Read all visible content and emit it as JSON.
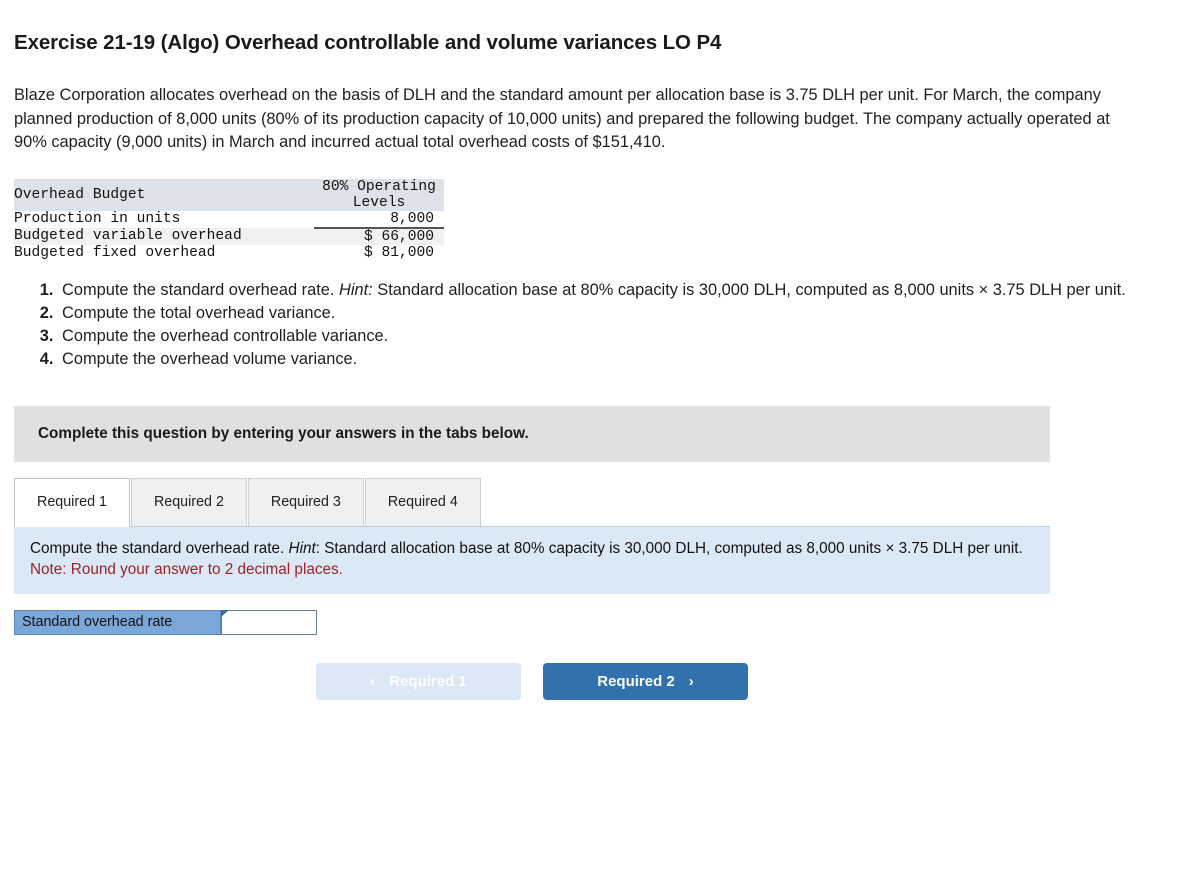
{
  "exercise": {
    "title": "Exercise 21-19 (Algo) Overhead controllable and volume variances LO P4",
    "intro": "Blaze Corporation allocates overhead on the basis of DLH and the standard amount per allocation base is 3.75 DLH per unit. For March, the company planned production of 8,000 units (80% of its production capacity of 10,000 units) and prepared the following budget. The company actually operated at 90% capacity (9,000 units) in March and incurred actual total overhead costs of $151,410."
  },
  "budget_table": {
    "header_label": "Overhead Budget",
    "header_column": "80% Operating Levels",
    "header_column_line1": "80% Operating",
    "header_column_line2": "Levels",
    "rows": [
      {
        "label": "Production in units",
        "value": "8,000"
      },
      {
        "label": "Budgeted variable overhead",
        "value": "$ 66,000"
      },
      {
        "label": "Budgeted fixed overhead",
        "value": "$ 81,000"
      }
    ]
  },
  "requirements": [
    {
      "pre": "Compute the standard overhead rate. ",
      "hint": "Hint:",
      "post": " Standard allocation base at 80% capacity is 30,000 DLH, computed as 8,000 units × 3.75 DLH per unit."
    },
    {
      "pre": "Compute the total overhead variance.",
      "hint": "",
      "post": ""
    },
    {
      "pre": "Compute the overhead controllable variance.",
      "hint": "",
      "post": ""
    },
    {
      "pre": "Compute the overhead volume variance.",
      "hint": "",
      "post": ""
    }
  ],
  "banner": {
    "text": "Complete this question by entering your answers in the tabs below."
  },
  "tabs": [
    {
      "label": "Required 1",
      "active": true
    },
    {
      "label": "Required 2",
      "active": false
    },
    {
      "label": "Required 3",
      "active": false
    },
    {
      "label": "Required 4",
      "active": false
    }
  ],
  "instruction_panel": {
    "pre": "Compute the standard overhead rate. ",
    "hint": "Hint",
    "post": ": Standard allocation base at 80% capacity is 30,000 DLH, computed as 8,000 units × 3.75 DLH per unit.",
    "note": "Note: Round your answer to 2 decimal places."
  },
  "answer": {
    "label": "Standard overhead rate",
    "value": "",
    "placeholder": ""
  },
  "navigation": {
    "prev_label": "Required 1",
    "prev_chevron": "‹",
    "next_label": "Required 2",
    "next_chevron": "›"
  },
  "colors": {
    "banner_grey": "#e0e0e0",
    "panel_blue": "#dbe9f6",
    "label_blue": "#7ba7d8",
    "button_blue": "#3071ae",
    "button_disabled": "#dbe7f4",
    "note_red": "#9b2226",
    "table_header": "#dde2e9"
  }
}
